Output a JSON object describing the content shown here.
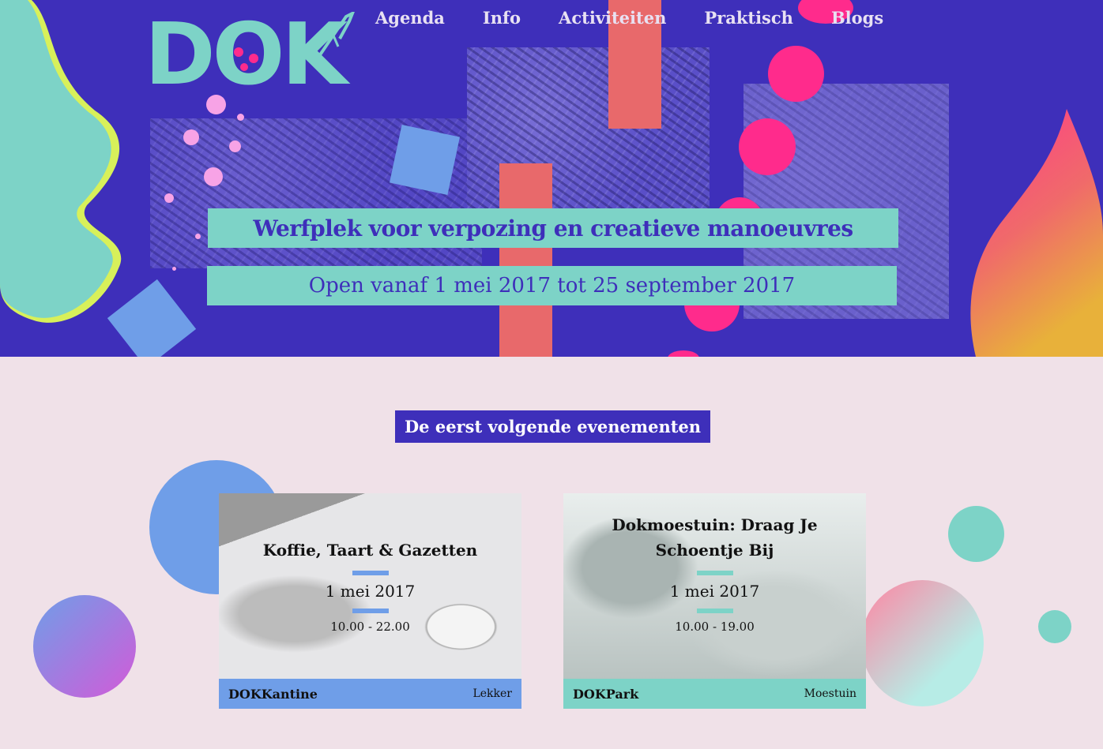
{
  "logo": {
    "text": "DOK"
  },
  "nav": {
    "items": [
      "Agenda",
      "Info",
      "Activiteiten",
      "Praktisch",
      "Blogs"
    ]
  },
  "hero": {
    "title": "Werfplek voor verpozing en creatieve manoeuvres",
    "subtitle": "Open vanaf 1 mei 2017 tot 25 september 2017"
  },
  "events": {
    "heading": "De eerst volgende evenementen",
    "cards": [
      {
        "title": "Koffie, Taart & Gazetten",
        "date": "1 mei 2017",
        "time": "10.00 - 22.00",
        "venue": "DOKKantine",
        "tag": "Lekker",
        "accent": "#6f9ee8"
      },
      {
        "title_line1": "Dokmoestuin: Draag Je",
        "title_line2": "Schoentje Bij",
        "date": "1 mei 2017",
        "time": "10.00 - 19.00",
        "venue": "DOKPark",
        "tag": "Moestuin",
        "accent": "#7dd3c7"
      }
    ]
  },
  "colors": {
    "hero_bg": "#3e2fba",
    "page_bg": "#f0e1e8",
    "mint": "#7dd3c7",
    "pink": "#ff2b8c",
    "coral": "#e8696b",
    "blue": "#6f9ee8"
  }
}
